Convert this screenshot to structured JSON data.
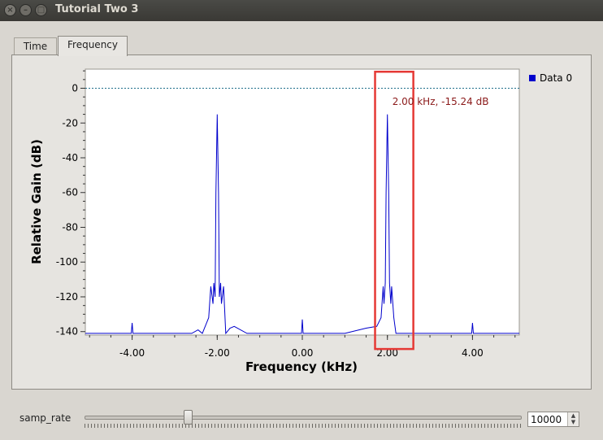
{
  "window": {
    "title": "Tutorial Two 3"
  },
  "tabs": [
    {
      "label": "Time"
    },
    {
      "label": "Frequency"
    }
  ],
  "plot": {
    "legend_label": "Data 0",
    "marker_text": "2.00 kHz, -15.24 dB"
  },
  "controls": {
    "samp_rate_label": "samp_rate",
    "samp_rate_value": "10000"
  },
  "colors": {
    "trace": "#0000cc",
    "marker_text": "#8b1a1a",
    "highlight": "#e53935",
    "reference_line": "#1f6f8b"
  },
  "chart_data": {
    "type": "line",
    "xlabel": "Frequency (kHz)",
    "ylabel": "Relative Gain (dB)",
    "xlim": [
      -5.1,
      5.1
    ],
    "ylim": [
      -142,
      11
    ],
    "xticks": [
      "-4.00",
      "-2.00",
      "0.00",
      "2.00",
      "4.00"
    ],
    "xtick_values": [
      -4,
      -2,
      0,
      2,
      4
    ],
    "yticks": [
      "0",
      "-20",
      "-40",
      "-60",
      "-80",
      "-100",
      "-120",
      "-140"
    ],
    "ytick_values": [
      0,
      -20,
      -40,
      -60,
      -80,
      -100,
      -120,
      -140
    ],
    "reference_level": 0,
    "series": [
      {
        "name": "Data 0",
        "x": [
          -5.1,
          -4.02,
          -4.0,
          -3.98,
          -2.6,
          -2.45,
          -2.35,
          -2.2,
          -2.15,
          -2.1,
          -2.08,
          -2.05,
          -2.03,
          -2.0,
          -1.97,
          -1.95,
          -1.92,
          -1.9,
          -1.85,
          -1.8,
          -1.7,
          -1.6,
          -1.3,
          -0.02,
          0.0,
          0.02,
          1.0,
          1.5,
          1.75,
          1.85,
          1.9,
          1.92,
          1.95,
          1.97,
          2.0,
          2.03,
          2.05,
          2.08,
          2.1,
          2.15,
          2.2,
          2.5,
          3.98,
          4.0,
          4.02,
          5.1
        ],
        "y": [
          -141,
          -141,
          -135,
          -141,
          -141,
          -139,
          -141,
          -132,
          -114,
          -124,
          -112,
          -120,
          -60,
          -15,
          -60,
          -120,
          -112,
          -124,
          -114,
          -141,
          -138,
          -137,
          -141,
          -141,
          -133,
          -141,
          -141,
          -138,
          -137,
          -132,
          -114,
          -124,
          -112,
          -60,
          -15,
          -60,
          -112,
          -124,
          -114,
          -132,
          -141,
          -141,
          -141,
          -135,
          -141,
          -141
        ]
      }
    ],
    "annotation": {
      "x": 2.0,
      "y": -15.24,
      "text": "2.00 kHz, -15.24 dB"
    },
    "legend": "top-right"
  }
}
